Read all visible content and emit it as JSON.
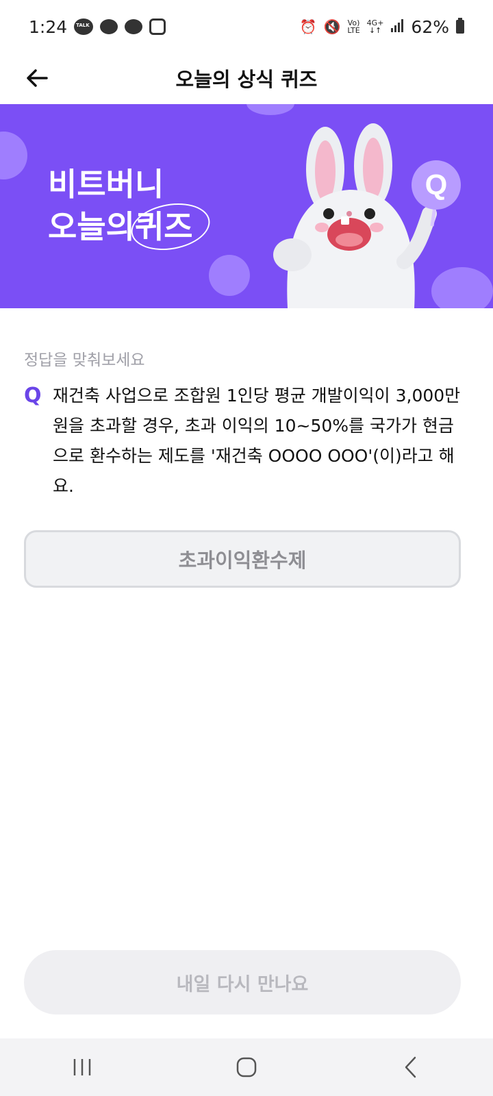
{
  "status_bar": {
    "time": "1:24",
    "battery_percent": "62%",
    "lte_label": "LTE",
    "network_label": "4G+"
  },
  "app_bar": {
    "title": "오늘의 상식 퀴즈"
  },
  "banner": {
    "line1": "비트버니",
    "line2_prefix": "오늘의",
    "line2_highlight": "퀴즈"
  },
  "quiz": {
    "prompt": "정답을 맞춰보세요",
    "q_mark": "Q",
    "question": "재건축 사업으로 조합원 1인당 평균 개발이익이 3,000만 원을 초과할 경우, 초과 이익의 10~50%를 국가가 현금으로 환수하는 제도를 '재건축 OOOO OOO'(이)라고 해요.",
    "answer": "초과이익환수제"
  },
  "footer": {
    "button_label": "내일 다시 만나요"
  },
  "colors": {
    "banner_bg": "#7b4ff5",
    "accent": "#6a45e8"
  }
}
